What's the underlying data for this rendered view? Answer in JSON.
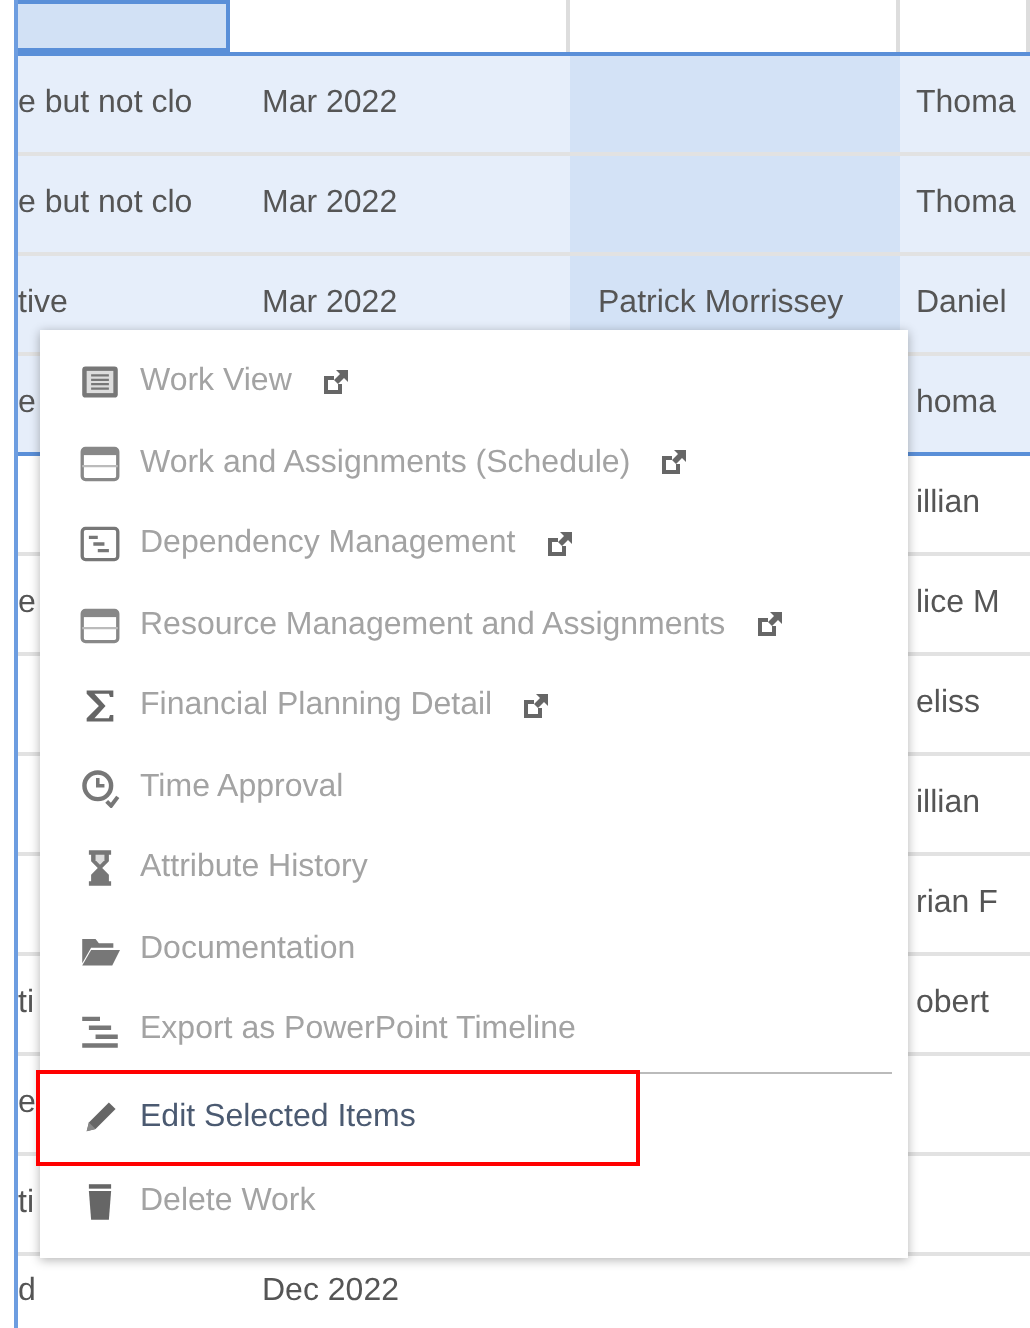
{
  "table": {
    "header": {
      "first_selected": true
    },
    "rows": [
      {
        "selected": true,
        "cells": [
          "e but not clo",
          "Mar 2022",
          "",
          "Thoma"
        ]
      },
      {
        "selected": true,
        "cells": [
          "e but not clo",
          "Mar 2022",
          "",
          "Thoma"
        ]
      },
      {
        "selected": true,
        "cells": [
          "tive",
          "Mar 2022",
          "Patrick Morrissey",
          "Daniel"
        ]
      },
      {
        "selected": true,
        "cells": [
          "e",
          "",
          "",
          "homa"
        ]
      },
      {
        "selected": false,
        "cells": [
          "",
          "",
          "",
          "illian"
        ]
      },
      {
        "selected": false,
        "cells": [
          "e",
          "",
          "",
          "lice M"
        ]
      },
      {
        "selected": false,
        "cells": [
          "",
          "",
          "",
          "eliss"
        ]
      },
      {
        "selected": false,
        "cells": [
          "",
          "",
          "",
          "illian"
        ]
      },
      {
        "selected": false,
        "cells": [
          "",
          "",
          "",
          "rian F"
        ]
      },
      {
        "selected": false,
        "cells": [
          "ti",
          "",
          "",
          "obert"
        ]
      },
      {
        "selected": false,
        "cells": [
          "e",
          "",
          "",
          ""
        ]
      },
      {
        "selected": false,
        "cells": [
          "ti",
          "",
          "",
          ""
        ]
      },
      {
        "selected": false,
        "cells": [
          "d",
          "Dec 2022",
          "",
          ""
        ]
      }
    ]
  },
  "context_menu": {
    "items": [
      {
        "label": "Work View",
        "external": true,
        "disabled": true,
        "highlighted": false
      },
      {
        "label": "Work and Assignments (Schedule)",
        "external": true,
        "disabled": true,
        "highlighted": false
      },
      {
        "label": "Dependency Management",
        "external": true,
        "disabled": true,
        "highlighted": false
      },
      {
        "label": "Resource Management and Assignments",
        "external": true,
        "disabled": true,
        "highlighted": false
      },
      {
        "label": "Financial Planning Detail",
        "external": true,
        "disabled": true,
        "highlighted": false
      },
      {
        "label": "Time Approval",
        "external": false,
        "disabled": true,
        "highlighted": false
      },
      {
        "label": "Attribute History",
        "external": false,
        "disabled": true,
        "highlighted": false
      },
      {
        "label": "Documentation",
        "external": false,
        "disabled": true,
        "highlighted": false
      },
      {
        "label": "Export as PowerPoint Timeline",
        "external": false,
        "disabled": true,
        "highlighted": false
      },
      {
        "kind": "separator"
      },
      {
        "label": "Edit Selected Items",
        "external": false,
        "disabled": false,
        "highlighted": true
      },
      {
        "label": "Delete Work",
        "external": false,
        "disabled": true,
        "highlighted": false
      }
    ]
  }
}
